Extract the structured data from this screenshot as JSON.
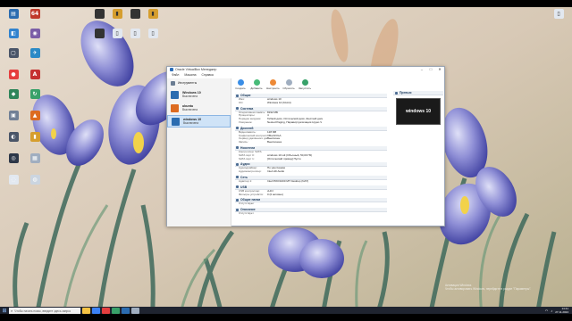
{
  "desktop": {
    "icons": [
      {
        "label": "",
        "color": "#2b6cb0",
        "glyph": "▤"
      },
      {
        "label": "64",
        "color": "#c0392b",
        "glyph": "64"
      },
      {
        "label": "",
        "color": "#3182ce",
        "glyph": "◧"
      },
      {
        "label": "",
        "color": "#7b5ea7",
        "glyph": "◉"
      },
      {
        "label": "",
        "color": "#4a5568",
        "glyph": "▢"
      },
      {
        "label": "",
        "color": "#2b8ac6",
        "glyph": "✈"
      },
      {
        "label": "",
        "color": "#e53e3e",
        "glyph": "●"
      },
      {
        "label": "",
        "color": "#c53030",
        "glyph": "A"
      },
      {
        "label": "",
        "color": "#2f855a",
        "glyph": "◆"
      },
      {
        "label": "",
        "color": "#38a169",
        "glyph": "↻"
      },
      {
        "label": "",
        "color": "#718096",
        "glyph": "▣"
      },
      {
        "label": "",
        "color": "#dd6b20",
        "glyph": "▲"
      },
      {
        "label": "",
        "color": "#4a5568",
        "glyph": "◐"
      },
      {
        "label": "",
        "color": "#d69e2e",
        "glyph": "▮"
      },
      {
        "label": "",
        "color": "#2d3748",
        "glyph": "◎"
      },
      {
        "label": "",
        "color": "#a0aec0",
        "glyph": "▦"
      },
      {
        "label": "",
        "color": "#e2e8f0",
        "glyph": "◌"
      },
      {
        "label": "",
        "color": "#cbd5e0",
        "glyph": "◍"
      }
    ],
    "top_icons": [
      {
        "color": "#333",
        "glyph": "▮"
      },
      {
        "color": "#d69e2e",
        "glyph": "▮"
      },
      {
        "color": "#333",
        "glyph": "▮"
      },
      {
        "color": "#d69e2e",
        "glyph": "▮"
      },
      {
        "color": "#333",
        "glyph": "▮"
      },
      {
        "color": "#e2e8f0",
        "glyph": "▯"
      },
      {
        "color": "#e2e8f0",
        "glyph": "▯"
      },
      {
        "color": "#e2e8f0",
        "glyph": "▯"
      },
      {
        "color": "#e2e8f0",
        "glyph": "▯"
      }
    ]
  },
  "window": {
    "title": "Oracle VirtualBox Менеджер",
    "menu": [
      "Файл",
      "Машина",
      "Справка"
    ],
    "tools_label": "Инструменты",
    "vms": [
      {
        "name": "Windows 10",
        "state": "Выключена",
        "color": "#2b6cb0",
        "selected": false
      },
      {
        "name": "ubuntu",
        "state": "Выключена",
        "color": "#dd6b20",
        "selected": false
      },
      {
        "name": "windows 10",
        "state": "Выключена",
        "color": "#2b6cb0",
        "selected": true
      }
    ],
    "toolbar": [
      {
        "label": "Создать",
        "color": "#3a8ee6"
      },
      {
        "label": "Добавить",
        "color": "#48bb78"
      },
      {
        "label": "Настроить",
        "color": "#ed8936"
      },
      {
        "label": "Сбросить",
        "color": "#a0aec0"
      },
      {
        "label": "Запустить",
        "color": "#38a169"
      }
    ],
    "sections": [
      {
        "title": "Общие",
        "rows": [
          [
            "Имя:",
            "windows 10"
          ],
          [
            "ОС:",
            "Windows 10 (64-bit)"
          ]
        ]
      },
      {
        "title": "Система",
        "rows": [
          [
            "Оперативная память:",
            "8192 МБ"
          ],
          [
            "Процессоры:",
            "4"
          ],
          [
            "Порядок загрузки:",
            "Гибкий диск, Оптический диск, Жесткий диск"
          ],
          [
            "Ускорение:",
            "Nested Paging, Паравиртуализация Hyper-V"
          ]
        ]
      },
      {
        "title": "Дисплей",
        "rows": [
          [
            "Видеопамять:",
            "128 МБ"
          ],
          [
            "Графический контроллер:",
            "VBoxSVGA"
          ],
          [
            "Сервер удалённого дисплея:",
            "Выключен"
          ],
          [
            "Запись:",
            "Выключена"
          ]
        ]
      },
      {
        "title": "Носители",
        "rows": [
          [
            "Контроллер: SATA",
            ""
          ],
          [
            "SATA порт 0:",
            "windows 10.vdi (Обычный, 50,00 ГБ)"
          ],
          [
            "SATA порт 1:",
            "[Оптический привод] Пусто"
          ]
        ]
      },
      {
        "title": "Аудио",
        "rows": [
          [
            "Аудиодрайвер:",
            "По умолчанию"
          ],
          [
            "Аудиоконтроллер:",
            "Intel HD Audio"
          ]
        ]
      },
      {
        "title": "Сеть",
        "rows": [
          [
            "Адаптер 1:",
            "Intel PRO/1000 MT Desktop (NAT)"
          ]
        ]
      },
      {
        "title": "USB",
        "rows": [
          [
            "USB контроллер:",
            "xHCI"
          ],
          [
            "Фильтры устройств:",
            "0 (0 активно)"
          ]
        ]
      },
      {
        "title": "Общие папки",
        "rows": [
          [
            "Отсутствуют",
            ""
          ]
        ]
      },
      {
        "title": "Описание",
        "rows": [
          [
            "Отсутствует",
            ""
          ]
        ]
      }
    ],
    "preview_title": "Превью",
    "preview_text": "windows 10"
  },
  "taskbar": {
    "search_placeholder": "Чтобы начать поиск, введите здесь запрос",
    "apps": [
      "#f6c343",
      "#3b82f6",
      "#e53e3e",
      "#38a169",
      "#2b6cb0",
      "#a0aec0"
    ],
    "time": "14:41",
    "date": "27.11.2024"
  },
  "activation": {
    "line1": "Активация Windows",
    "line2": "Чтобы активировать Windows, перейдите в раздел \"Параметры\"."
  }
}
